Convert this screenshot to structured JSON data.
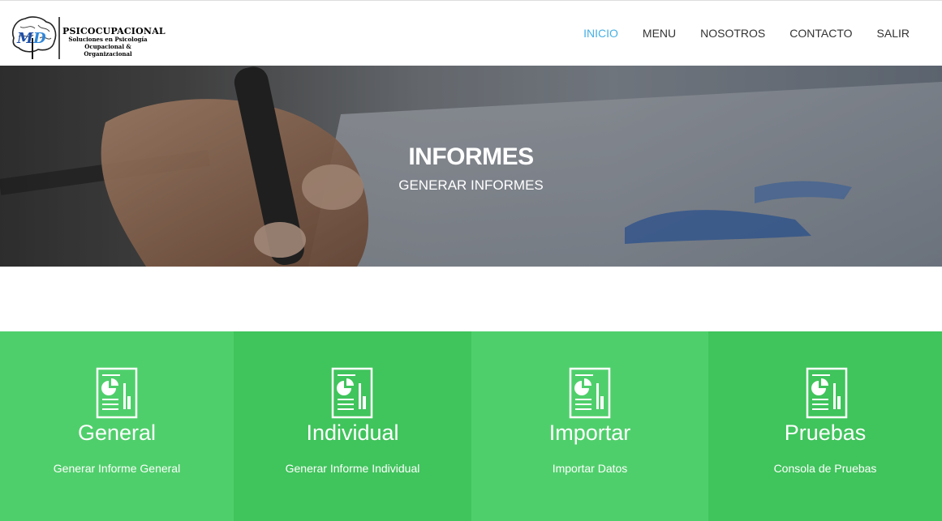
{
  "brand": {
    "title": "PSICOCUPACIONAL",
    "subtitle_line1": "Soluciones en Psicología",
    "subtitle_line2": "Ocupacional & Organizacional"
  },
  "nav": [
    {
      "label": "INICIO",
      "active": true
    },
    {
      "label": "MENU",
      "active": false
    },
    {
      "label": "NOSOTROS",
      "active": false
    },
    {
      "label": "CONTACTO",
      "active": false
    },
    {
      "label": "SALIR",
      "active": false
    }
  ],
  "hero": {
    "title": "INFORMES",
    "subtitle": "GENERAR INFORMES"
  },
  "tiles": [
    {
      "title": "General",
      "description": "Generar Informe General",
      "icon": "report-chart-icon"
    },
    {
      "title": "Individual",
      "description": "Generar Informe Individual",
      "icon": "report-chart-icon"
    },
    {
      "title": "Importar",
      "description": "Importar Datos",
      "icon": "report-chart-icon"
    },
    {
      "title": "Pruebas",
      "description": "Consola de Pruebas",
      "icon": "report-chart-icon"
    }
  ],
  "colors": {
    "nav_active": "#47b0e4",
    "tile_light": "#4fcf6b",
    "tile_dark": "#40c45c"
  }
}
